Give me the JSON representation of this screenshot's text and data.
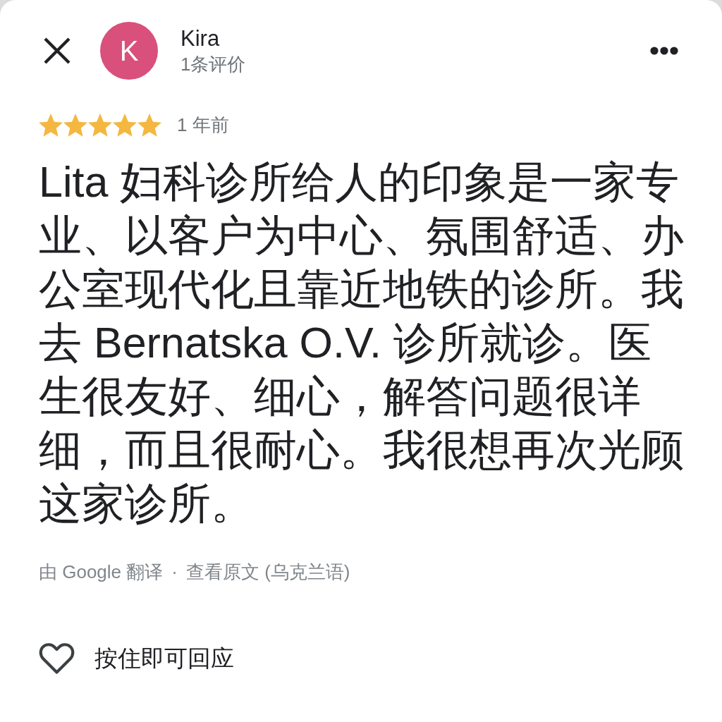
{
  "reviewer": {
    "avatar_letter": "K",
    "name": "Kira",
    "review_count": "1条评价"
  },
  "review": {
    "stars": 5,
    "time": "1 年前",
    "text": "Lita 妇科诊所给人的印象是一家专业、以客户为中心、氛围舒适、办公室现代化且靠近地铁的诊所。我去 Bernatska O.V. 诊所就诊。医生很友好、细心，解答问题很详细，而且很耐心。我很想再次光顾这家诊所。"
  },
  "translation": {
    "note": "由 Google 翻译",
    "separator": "·",
    "link": "查看原文 (乌克兰语)"
  },
  "reaction": {
    "hint": "按住即可回应"
  }
}
